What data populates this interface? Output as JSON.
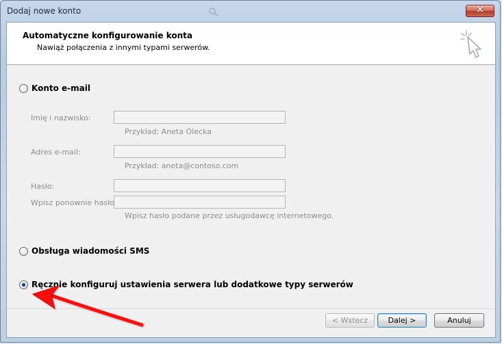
{
  "window": {
    "title": "Dodaj nowe konto",
    "close_label": "✕"
  },
  "header": {
    "title": "Automatyczne konfigurowanie konta",
    "subtitle": "Nawiąż połączenia z innymi typami serwerów."
  },
  "options": {
    "email": {
      "label": "Konto e-mail",
      "selected": false
    },
    "sms": {
      "label": "Obsługa wiadomości SMS",
      "selected": false
    },
    "manual": {
      "label": "Ręcznie konfiguruj ustawienia serwera lub dodatkowe typy serwerów",
      "selected": true
    }
  },
  "email_form": {
    "name_label": "Imię i nazwisko:",
    "name_value": "",
    "name_hint": "Przykład: Aneta Olecka",
    "email_label": "Adres e-mail:",
    "email_value": "",
    "email_hint": "Przykład: aneta@contoso.com",
    "password_label": "Hasło:",
    "password_value": "",
    "password_repeat_label": "Wpisz ponownie hasło:",
    "password_repeat_value": "",
    "password_hint": "Wpisz hasło podane przez usługodawcę internetowego."
  },
  "buttons": {
    "back": "< Wstecz",
    "next": "Dalej >",
    "cancel": "Anuluj"
  },
  "colors": {
    "annotation_arrow": "#ff0000",
    "title_close": "#c84d3f",
    "default_button_border": "#3c7fb1"
  },
  "icons": {
    "title_ghost_search": "search-icon",
    "wizard": "cursor-sparkle-icon",
    "annotation": "red-arrow-icon"
  }
}
